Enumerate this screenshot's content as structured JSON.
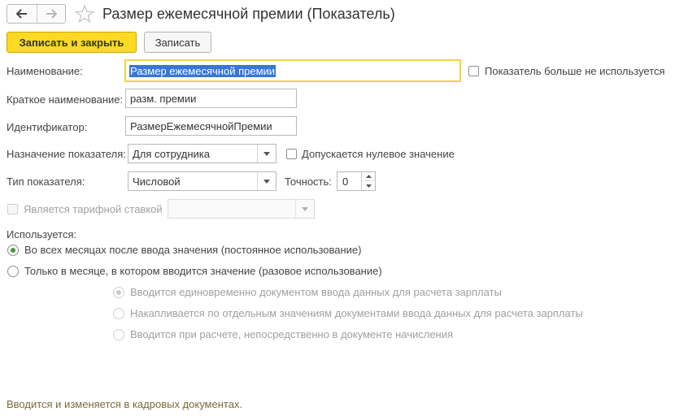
{
  "window": {
    "title": "Размер ежемесячной премии (Показатель)"
  },
  "toolbar": {
    "save_close_label": "Записать и закрыть",
    "save_label": "Записать"
  },
  "form": {
    "name": {
      "label": "Наименование:",
      "value": "Размер ежемесячной премии"
    },
    "not_used": {
      "label": "Показатель больше не используется",
      "checked": false
    },
    "short_name": {
      "label": "Краткое наименование:",
      "value": "разм. премии"
    },
    "identifier": {
      "label": "Идентификатор:",
      "value": "РазмерЕжемесячнойПремии"
    },
    "purpose": {
      "label": "Назначение показателя:",
      "value": "Для сотрудника"
    },
    "zero_allowed": {
      "label": "Допускается нулевое значение",
      "checked": false
    },
    "type": {
      "label": "Тип показателя:",
      "value": "Числовой"
    },
    "precision": {
      "label": "Точность:",
      "value": "0"
    },
    "tariff_rate": {
      "label": "Является тарифной ставкой",
      "checked": false,
      "value": ""
    },
    "usage": {
      "label": "Используется:",
      "options": [
        {
          "label": "Во всех месяцах после ввода значения (постоянное использование)",
          "selected": true
        },
        {
          "label": "Только в месяце, в котором вводится значение (разовое использование)",
          "selected": false
        }
      ],
      "suboptions": [
        {
          "label": "Вводится единовременно документом ввода данных для расчета зарплаты",
          "selected": true
        },
        {
          "label": "Накапливается по отдельным значениям документами ввода данных для расчета зарплаты",
          "selected": false
        },
        {
          "label": "Вводится при расчете, непосредственно в документе начисления",
          "selected": false
        }
      ]
    }
  },
  "footer": {
    "note": "Вводится и изменяется в кадровых документах."
  },
  "icons": {
    "back": "arrow-left-icon",
    "forward": "arrow-right-icon",
    "favorite": "star-icon",
    "dropdown": "chevron-down-icon"
  },
  "colors": {
    "primary_button": "#fbd924",
    "focus_border": "#f5d33c",
    "selection": "#3875d7",
    "radio_dot": "#4a9a3a",
    "footer_text": "#7a6a3a"
  }
}
